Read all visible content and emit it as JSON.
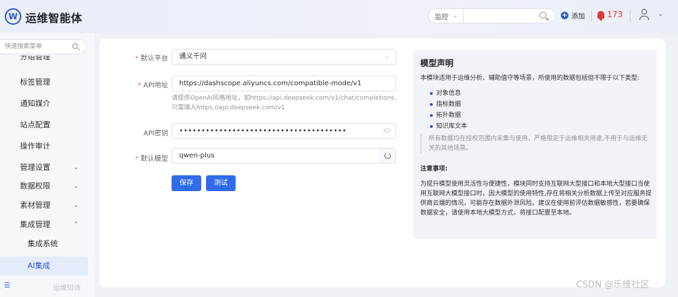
{
  "header": {
    "logo_letter": "W",
    "app_title": "运维智能体",
    "monitor_select": "监控",
    "add_label": "添加",
    "alarm_count": "173"
  },
  "sidebar": {
    "search_placeholder": "快速搜索菜单",
    "clipped_item": "分组管理",
    "items": [
      {
        "label": "标签管理"
      },
      {
        "label": "通知媒介"
      },
      {
        "label": "站点配置"
      },
      {
        "label": "操作审计"
      },
      {
        "label": "管理设置",
        "arrow": "⌄"
      },
      {
        "label": "数据权限",
        "arrow": "⌄"
      },
      {
        "label": "素材管理",
        "arrow": "⌄"
      },
      {
        "label": "集成管理",
        "arrow": "⌃"
      },
      {
        "label": "集成系统"
      },
      {
        "label": "AI集成"
      }
    ],
    "footer_text": "运维知诗"
  },
  "form": {
    "platform_label": "默认平台",
    "platform_value": "通义千问",
    "api_label": "API地址",
    "api_value": "https://dashscope.aliyuncs.com/compatible-mode/v1",
    "api_hint_1": "请提供OpenAI风格地址，如https://api.deepseek.com/v1/chat/completions,",
    "api_hint_2": "只需填入https://api.deepseek.com/v1",
    "key_label": "API密钥",
    "key_value": "••••••••••••••••••••••••••••••••••••••",
    "model_label": "默认模型",
    "model_value": "qwen-plus",
    "save_label": "保存",
    "test_label": "测试"
  },
  "declaration": {
    "title": "模型声明",
    "intro": "本模块适用于运维分析、辅助值守等场景，所使用的数据包括但不限于以下类型:",
    "list": [
      "对象信息",
      "指标数据",
      "拓扑数据",
      "知识库文本"
    ],
    "quote": "所有数据均在授权范围内采集与使用，严格限定于运维相关用途,不用于与运维无关的其他场景。",
    "note_title": "注意事项:",
    "body": "为提升模型使用灵活性与便捷性，模块同时支持互联网大型接口和本地大型接口当使用互联网大模型接口时，因大模型的使用特性,存在将相关分析数据上传至对应服务提供商云端的情况，可能存在数据外泄风险。建议在使用前评估数据敏感性，若要确保数据安全，请使用本地大模型方式，将接口配置至本地。"
  },
  "watermark": "CSDN @乐维社区"
}
